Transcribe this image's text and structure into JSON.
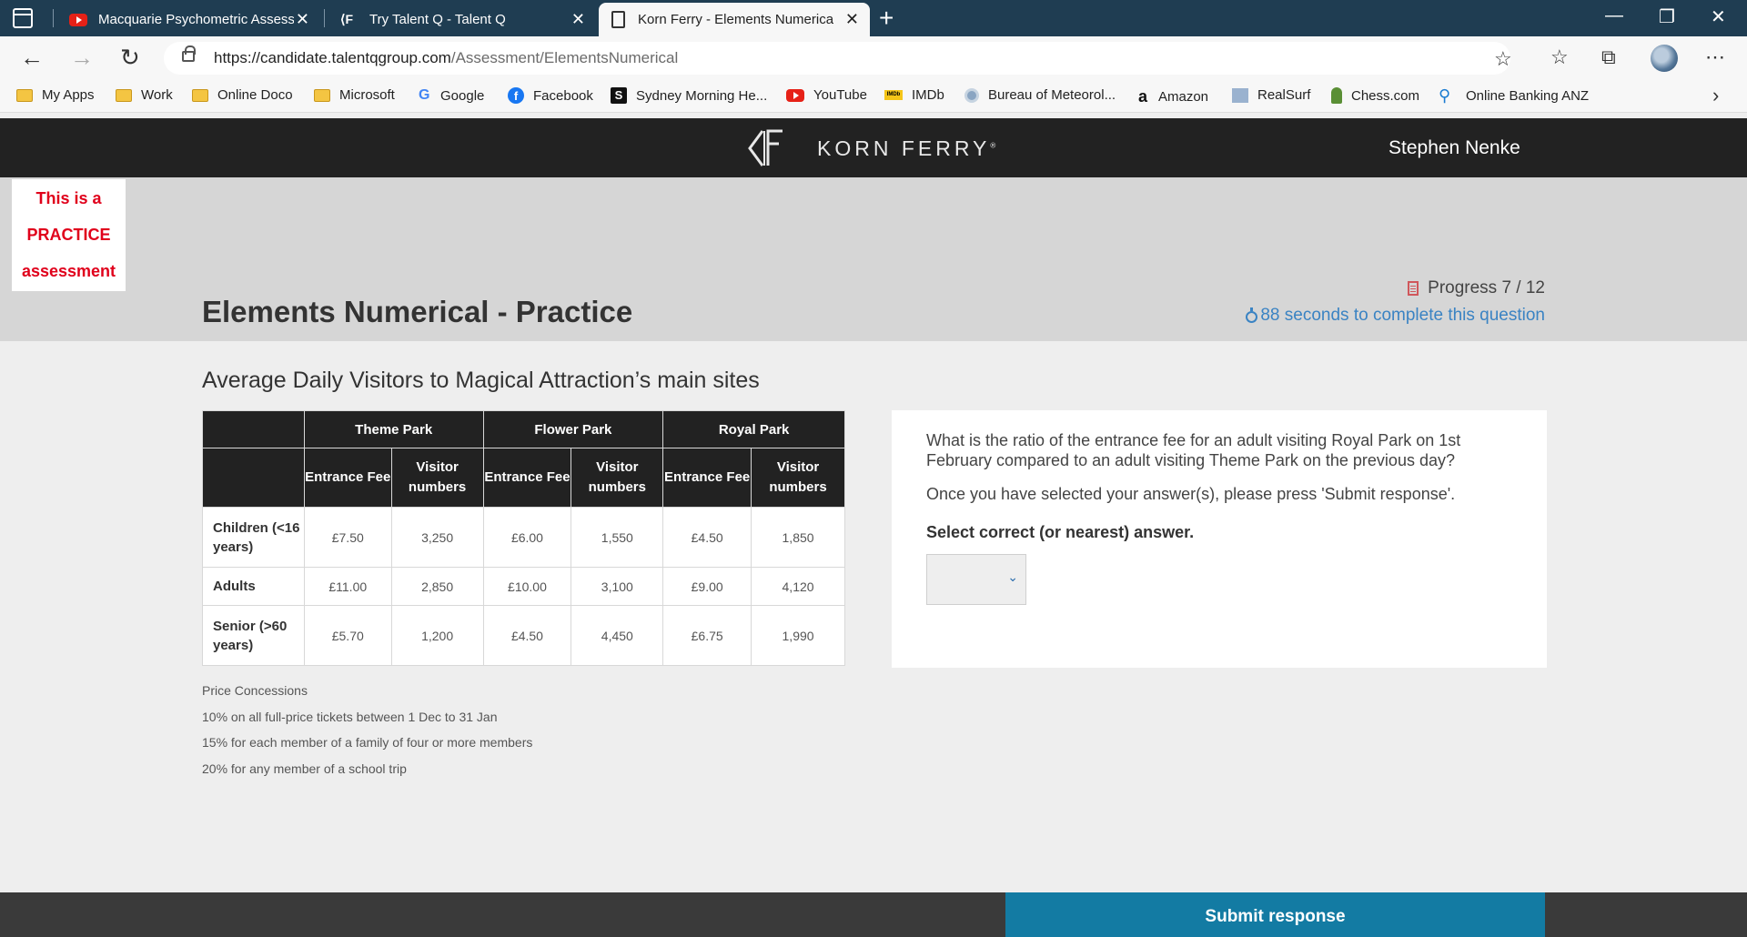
{
  "browser": {
    "tabs": [
      {
        "title": "Macquarie Psychometric Assessm"
      },
      {
        "title": "Try Talent Q - Talent Q"
      },
      {
        "title": "Korn Ferry - Elements Numerical"
      }
    ],
    "url_host": "https://candidate.talentqgroup.com",
    "url_path": "/Assessment/ElementsNumerical",
    "bookmarks": [
      "My Apps",
      "Work",
      "Online Doco",
      "Microsoft",
      "Google",
      "Facebook",
      "Sydney Morning He...",
      "YouTube",
      "IMDb",
      "Bureau of Meteorol...",
      "Amazon",
      "RealSurf",
      "Chess.com",
      "Online Banking ANZ"
    ]
  },
  "header": {
    "logo_text": "KORN FERRY",
    "user_name": "Stephen Nenke"
  },
  "badge": {
    "line1": "This is a",
    "line2": "PRACTICE",
    "line3": "assessment"
  },
  "page": {
    "title": "Elements Numerical - Practice",
    "progress_label": "Progress 7 / 12",
    "progress_current": 7,
    "progress_total": 12,
    "timer_text": "88 seconds to complete this question"
  },
  "table": {
    "title": "Average Daily Visitors to Magical Attraction’s main sites",
    "groups": [
      "Theme Park",
      "Flower Park",
      "Royal Park"
    ],
    "subheaders": [
      "Entrance Fee",
      "Visitor numbers",
      "Entrance Fee",
      "Visitor numbers",
      "Entrance Fee",
      "Visitor numbers"
    ],
    "rows": [
      {
        "label": "Children (<16 years)",
        "cells": [
          "£7.50",
          "3,250",
          "£6.00",
          "1,550",
          "£4.50",
          "1,850"
        ]
      },
      {
        "label": "Adults",
        "cells": [
          "£11.00",
          "2,850",
          "£10.00",
          "3,100",
          "£9.00",
          "4,120"
        ]
      },
      {
        "label": "Senior (>60 years)",
        "cells": [
          "£5.70",
          "1,200",
          "£4.50",
          "4,450",
          "£6.75",
          "1,990"
        ]
      }
    ]
  },
  "concessions": [
    "Price Concessions",
    "10% on all full-price tickets between 1 Dec to 31 Jan",
    "15% for each member of a family of four or more members",
    "20% for any member of a school trip"
  ],
  "question": {
    "text": "What is the ratio of the entrance fee for an adult visiting Royal Park on 1st February compared to an adult visiting Theme Park on the previous day?",
    "instruction": "Once you have selected your answer(s), please press 'Submit response'.",
    "select_label": "Select correct (or nearest) answer.",
    "selected_value": ""
  },
  "footer": {
    "submit_label": "Submit response"
  }
}
